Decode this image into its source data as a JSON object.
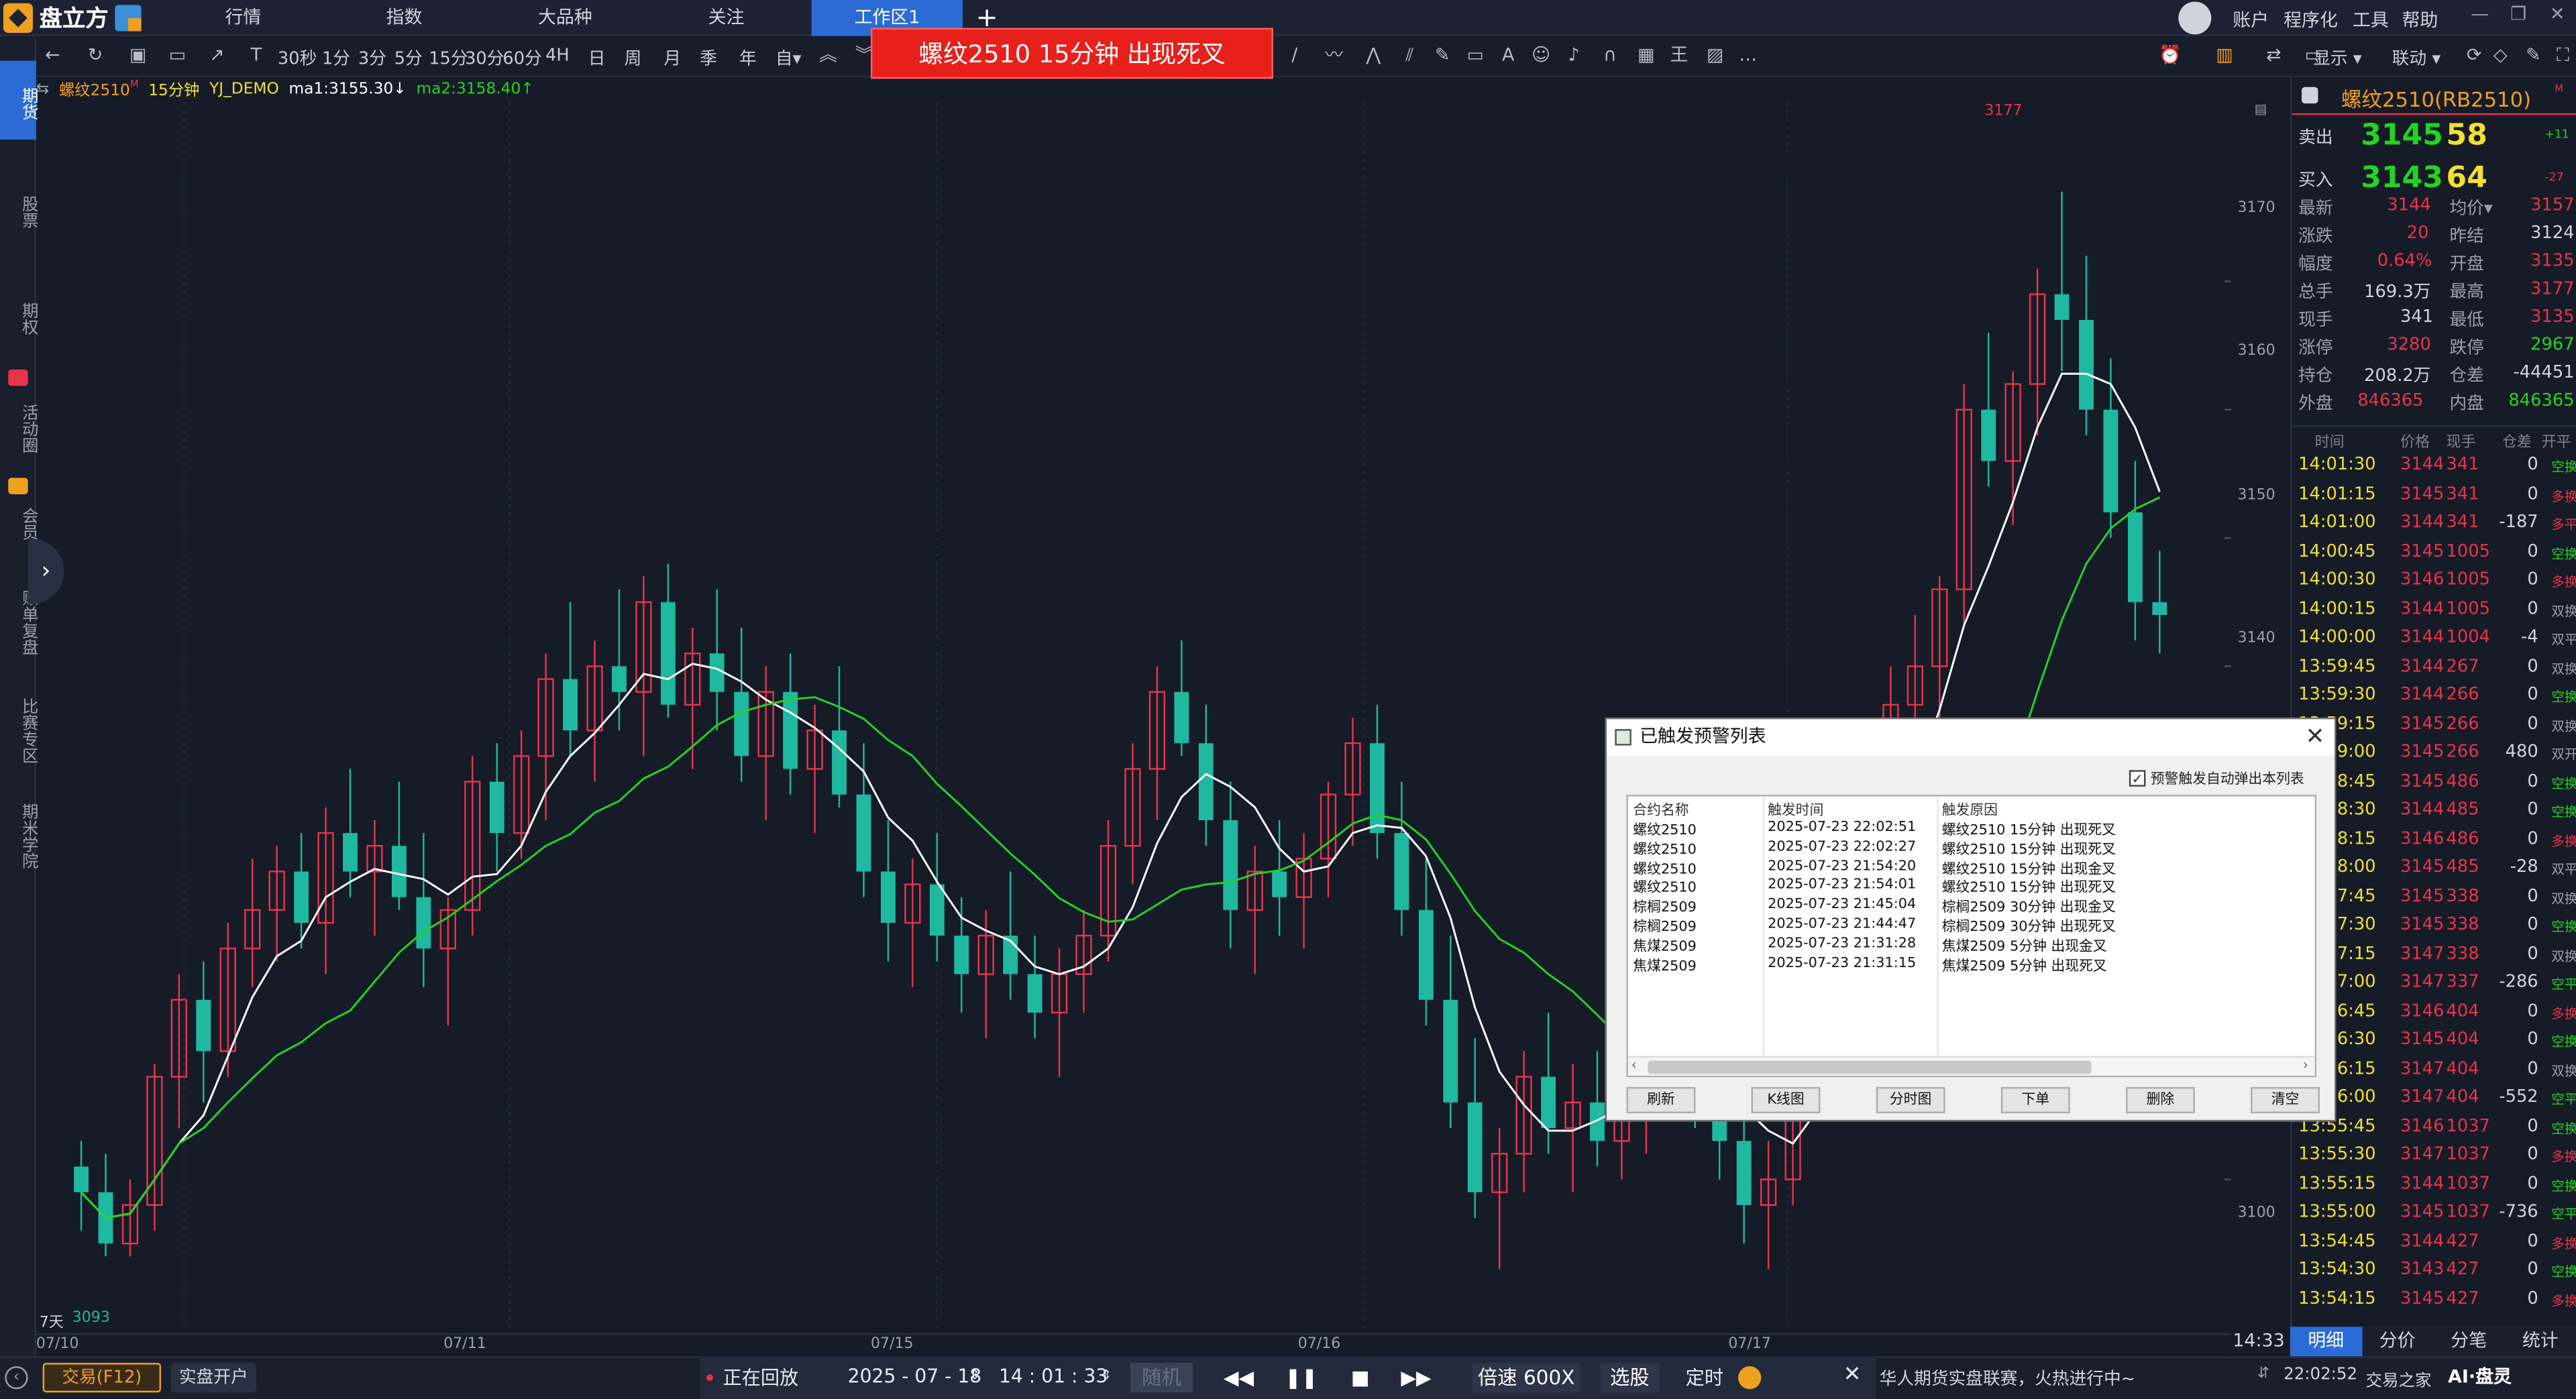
{
  "app": {
    "logo_text": "盘立方",
    "nav_tabs": [
      "行情",
      "指数",
      "大品种",
      "关注",
      "工作区1"
    ],
    "right_menu": [
      "账户",
      "程序化",
      "工具",
      "帮助"
    ]
  },
  "toolbar": {
    "periods": [
      "30秒",
      "1分",
      "3分",
      "5分",
      "15分",
      "30分",
      "60分",
      "4H",
      "日",
      "周",
      "月",
      "季",
      "年",
      "自▾"
    ],
    "right_buttons": [
      "显示 ▾",
      "联动 ▾"
    ]
  },
  "alert_banner": "螺纹2510 15分钟 出现死叉",
  "sidebar": [
    "期货",
    "股票",
    "期权",
    "活动圈",
    "会员",
    "账单复盘",
    "比赛专区",
    "期米学院"
  ],
  "legend": {
    "symbol": "螺纹2510",
    "symbol_sup": "M",
    "period": "15分钟",
    "account": "YJ_DEMO",
    "ma1": "ma1:3155.30↓",
    "ma2": "ma2:3158.40↑"
  },
  "colors": {
    "up": "#e8344a",
    "down": "#1fb8a0",
    "ma1": "#ffffff",
    "ma2": "#22d422",
    "accent": "#2b6bd6",
    "banner": "#e8201c",
    "price_yellow": "#f0e030"
  },
  "chart_data": {
    "type": "candlestick",
    "period": "15分钟",
    "ylim": [
      3088,
      3184
    ],
    "y_ticks": [
      3100,
      3140,
      3150,
      3160,
      3170
    ],
    "x_ticks": [
      "07/10",
      "07/11",
      "07/15",
      "07/16",
      "07/17"
    ],
    "high_label": "3177",
    "low_label": "3093",
    "days_label": "7天",
    "bars": [
      [
        3101,
        3103,
        3096,
        3099
      ],
      [
        3099,
        3102,
        3094,
        3095
      ],
      [
        3095,
        3100,
        3094,
        3098
      ],
      [
        3098,
        3109,
        3096,
        3108
      ],
      [
        3108,
        3116,
        3104,
        3114
      ],
      [
        3114,
        3117,
        3106,
        3110
      ],
      [
        3110,
        3120,
        3108,
        3118
      ],
      [
        3118,
        3125,
        3115,
        3121
      ],
      [
        3121,
        3126,
        3117,
        3124
      ],
      [
        3124,
        3127,
        3118,
        3120
      ],
      [
        3120,
        3129,
        3116,
        3127
      ],
      [
        3127,
        3132,
        3122,
        3124
      ],
      [
        3124,
        3128,
        3119,
        3126
      ],
      [
        3126,
        3131,
        3121,
        3122
      ],
      [
        3122,
        3127,
        3115,
        3118
      ],
      [
        3118,
        3122,
        3112,
        3121
      ],
      [
        3121,
        3133,
        3119,
        3131
      ],
      [
        3131,
        3134,
        3124,
        3127
      ],
      [
        3127,
        3135,
        3125,
        3133
      ],
      [
        3133,
        3141,
        3128,
        3139
      ],
      [
        3139,
        3145,
        3133,
        3135
      ],
      [
        3135,
        3142,
        3131,
        3140
      ],
      [
        3140,
        3146,
        3135,
        3138
      ],
      [
        3138,
        3147,
        3133,
        3145
      ],
      [
        3145,
        3148,
        3136,
        3137
      ],
      [
        3137,
        3143,
        3132,
        3141
      ],
      [
        3141,
        3146,
        3135,
        3138
      ],
      [
        3138,
        3143,
        3131,
        3133
      ],
      [
        3133,
        3140,
        3128,
        3138
      ],
      [
        3138,
        3141,
        3130,
        3132
      ],
      [
        3132,
        3137,
        3127,
        3135
      ],
      [
        3135,
        3140,
        3129,
        3130
      ],
      [
        3130,
        3134,
        3122,
        3124
      ],
      [
        3124,
        3128,
        3117,
        3120
      ],
      [
        3120,
        3125,
        3115,
        3123
      ],
      [
        3123,
        3127,
        3117,
        3119
      ],
      [
        3119,
        3122,
        3113,
        3116
      ],
      [
        3116,
        3121,
        3111,
        3119
      ],
      [
        3119,
        3124,
        3114,
        3116
      ],
      [
        3116,
        3119,
        3111,
        3113
      ],
      [
        3113,
        3118,
        3108,
        3116
      ],
      [
        3116,
        3121,
        3113,
        3119
      ],
      [
        3119,
        3128,
        3117,
        3126
      ],
      [
        3126,
        3134,
        3123,
        3132
      ],
      [
        3132,
        3140,
        3128,
        3138
      ],
      [
        3138,
        3142,
        3133,
        3134
      ],
      [
        3134,
        3137,
        3126,
        3128
      ],
      [
        3128,
        3131,
        3118,
        3121
      ],
      [
        3121,
        3126,
        3116,
        3124
      ],
      [
        3124,
        3128,
        3119,
        3122
      ],
      [
        3122,
        3127,
        3118,
        3125
      ],
      [
        3125,
        3131,
        3122,
        3130
      ],
      [
        3130,
        3136,
        3126,
        3134
      ],
      [
        3134,
        3137,
        3125,
        3127
      ],
      [
        3127,
        3131,
        3119,
        3121
      ],
      [
        3121,
        3125,
        3112,
        3114
      ],
      [
        3114,
        3119,
        3104,
        3106
      ],
      [
        3106,
        3111,
        3097,
        3099
      ],
      [
        3099,
        3104,
        3093,
        3102
      ],
      [
        3102,
        3110,
        3099,
        3108
      ],
      [
        3108,
        3113,
        3102,
        3104
      ],
      [
        3104,
        3109,
        3099,
        3106
      ],
      [
        3106,
        3110,
        3101,
        3103
      ],
      [
        3103,
        3108,
        3100,
        3107
      ],
      [
        3107,
        3111,
        3102,
        3109
      ],
      [
        3109,
        3114,
        3105,
        3112
      ],
      [
        3112,
        3115,
        3104,
        3106
      ],
      [
        3106,
        3110,
        3100,
        3103
      ],
      [
        3103,
        3107,
        3095,
        3098
      ],
      [
        3098,
        3103,
        3093,
        3100
      ],
      [
        3100,
        3108,
        3098,
        3107
      ],
      [
        3107,
        3121,
        3105,
        3119
      ],
      [
        3119,
        3130,
        3116,
        3127
      ],
      [
        3127,
        3136,
        3124,
        3133
      ],
      [
        3133,
        3140,
        3129,
        3137
      ],
      [
        3137,
        3144,
        3133,
        3140
      ],
      [
        3140,
        3147,
        3131,
        3146
      ],
      [
        3146,
        3162,
        3143,
        3160
      ],
      [
        3160,
        3166,
        3154,
        3156
      ],
      [
        3156,
        3163,
        3151,
        3162
      ],
      [
        3162,
        3171,
        3158,
        3169
      ],
      [
        3169,
        3177,
        3163,
        3167
      ],
      [
        3167,
        3172,
        3158,
        3160
      ],
      [
        3160,
        3164,
        3150,
        3152
      ],
      [
        3152,
        3156,
        3142,
        3145
      ],
      [
        3145,
        3149,
        3141,
        3144
      ]
    ],
    "ma1_note": "ma1 white line",
    "ma2_note": "ma2 green line"
  },
  "y_axis_labels": [
    "3170",
    "3160",
    "3150",
    "3140",
    "3100"
  ],
  "x_axis_labels": [
    "07/10",
    "07/11",
    "07/15",
    "07/16",
    "07/17"
  ],
  "quote": {
    "title": "螺纹2510(RB2510)",
    "title_sup": "M",
    "sell_label": "卖出",
    "sell_price": "3145",
    "sell_qty": "58",
    "sell_change": "+11",
    "buy_label": "买入",
    "buy_price": "3143",
    "buy_qty": "64",
    "buy_change": "-27",
    "rows": [
      {
        "l1": "最新",
        "v1": "3144",
        "l2": "均价▾",
        "v2": "3157"
      },
      {
        "l1": "涨跌",
        "v1": "20",
        "l2": "昨结",
        "v2": "3124"
      },
      {
        "l1": "幅度",
        "v1": "0.64%",
        "l2": "开盘",
        "v2": "3135"
      },
      {
        "l1": "总手",
        "v1": "169.3万",
        "l2": "最高",
        "v2": "3177"
      },
      {
        "l1": "现手",
        "v1": "341",
        "l2": "最低",
        "v2": "3135"
      },
      {
        "l1": "涨停",
        "v1": "3280",
        "l2": "跌停",
        "v2": "2967"
      },
      {
        "l1": "持仓",
        "v1": "208.2万",
        "l2": "仓差",
        "v2": "-44451"
      },
      {
        "l1": "外盘",
        "v1": "846365",
        "l2": "内盘",
        "v2": "846365"
      }
    ],
    "trade_headers": [
      "时间",
      "价格",
      "现手",
      "仓差",
      "开平"
    ],
    "trades": [
      {
        "t": "14:01:30",
        "p": "3144",
        "q": "341",
        "d": "0",
        "k": "空换"
      },
      {
        "t": "14:01:15",
        "p": "3145",
        "q": "341",
        "d": "0",
        "k": "多换"
      },
      {
        "t": "14:01:00",
        "p": "3144",
        "q": "341",
        "d": "-187",
        "k": "多平"
      },
      {
        "t": "14:00:45",
        "p": "3145",
        "q": "1005",
        "d": "0",
        "k": "空换"
      },
      {
        "t": "14:00:30",
        "p": "3146",
        "q": "1005",
        "d": "0",
        "k": "多换"
      },
      {
        "t": "14:00:15",
        "p": "3144",
        "q": "1005",
        "d": "0",
        "k": "双换"
      },
      {
        "t": "14:00:00",
        "p": "3144",
        "q": "1004",
        "d": "-4",
        "k": "双平"
      },
      {
        "t": "13:59:45",
        "p": "3144",
        "q": "267",
        "d": "0",
        "k": "双换"
      },
      {
        "t": "13:59:30",
        "p": "3144",
        "q": "266",
        "d": "0",
        "k": "空换"
      },
      {
        "t": "13:59:15",
        "p": "3145",
        "q": "266",
        "d": "0",
        "k": "双换"
      },
      {
        "t": "13:59:00",
        "p": "3145",
        "q": "266",
        "d": "480",
        "k": "双开"
      },
      {
        "t": "13:58:45",
        "p": "3145",
        "q": "486",
        "d": "0",
        "k": "空换"
      },
      {
        "t": "13:58:30",
        "p": "3144",
        "q": "485",
        "d": "0",
        "k": "空换"
      },
      {
        "t": "13:58:15",
        "p": "3146",
        "q": "486",
        "d": "0",
        "k": "多换"
      },
      {
        "t": "13:58:00",
        "p": "3145",
        "q": "485",
        "d": "-28",
        "k": "双平"
      },
      {
        "t": "13:57:45",
        "p": "3145",
        "q": "338",
        "d": "0",
        "k": "双换"
      },
      {
        "t": "13:57:30",
        "p": "3145",
        "q": "338",
        "d": "0",
        "k": "空换"
      },
      {
        "t": "13:57:15",
        "p": "3147",
        "q": "338",
        "d": "0",
        "k": "双换"
      },
      {
        "t": "13:57:00",
        "p": "3147",
        "q": "337",
        "d": "-286",
        "k": "空平"
      },
      {
        "t": "13:56:45",
        "p": "3146",
        "q": "404",
        "d": "0",
        "k": "多换"
      },
      {
        "t": "13:56:30",
        "p": "3145",
        "q": "404",
        "d": "0",
        "k": "空换"
      },
      {
        "t": "13:56:15",
        "p": "3147",
        "q": "404",
        "d": "0",
        "k": "双换"
      },
      {
        "t": "13:56:00",
        "p": "3147",
        "q": "404",
        "d": "-552",
        "k": "空平"
      },
      {
        "t": "13:55:45",
        "p": "3146",
        "q": "1037",
        "d": "0",
        "k": "空换"
      },
      {
        "t": "13:55:30",
        "p": "3147",
        "q": "1037",
        "d": "0",
        "k": "多换"
      },
      {
        "t": "13:55:15",
        "p": "3144",
        "q": "1037",
        "d": "0",
        "k": "空换"
      },
      {
        "t": "13:55:00",
        "p": "3145",
        "q": "1037",
        "d": "-736",
        "k": "空平"
      },
      {
        "t": "13:54:45",
        "p": "3144",
        "q": "427",
        "d": "0",
        "k": "多换"
      },
      {
        "t": "13:54:30",
        "p": "3143",
        "q": "427",
        "d": "0",
        "k": "空换"
      },
      {
        "t": "13:54:15",
        "p": "3145",
        "q": "427",
        "d": "0",
        "k": "多换"
      }
    ],
    "tabs": [
      "明细",
      "分价",
      "分笔",
      "统计"
    ],
    "time_label": "14:33"
  },
  "playbar": {
    "status": "正在回放",
    "date": "2025 - 07 - 18",
    "time": "14 : 01 : 33",
    "random": "随机",
    "speed_label": "倍速",
    "speed": "600X",
    "pick": "选股",
    "timer": "定时"
  },
  "statusbar": {
    "trade_btn": "交易(F12)",
    "open_account": "实盘开户",
    "ticker": "华人期货实盘联赛，火热进行中~",
    "clock": "22:02:52",
    "home": "交易之家",
    "ai": "AI·盘灵"
  },
  "dialog": {
    "title": "已触发预警列表",
    "auto_popup": "预警触发自动弹出本列表",
    "headers": [
      "合约名称",
      "触发时间",
      "触发原因"
    ],
    "rows": [
      {
        "name": "螺纹2510",
        "time": "2025-07-23 22:02:51",
        "reason": "螺纹2510 15分钟 出现死叉"
      },
      {
        "name": "螺纹2510",
        "time": "2025-07-23 22:02:27",
        "reason": "螺纹2510 15分钟 出现死叉"
      },
      {
        "name": "螺纹2510",
        "time": "2025-07-23 21:54:20",
        "reason": "螺纹2510 15分钟 出现金叉"
      },
      {
        "name": "螺纹2510",
        "time": "2025-07-23 21:54:01",
        "reason": "螺纹2510 15分钟 出现死叉"
      },
      {
        "name": "棕榈2509",
        "time": "2025-07-23 21:45:04",
        "reason": "棕榈2509 30分钟 出现金叉"
      },
      {
        "name": "棕榈2509",
        "time": "2025-07-23 21:44:47",
        "reason": "棕榈2509 30分钟 出现死叉"
      },
      {
        "name": "焦煤2509",
        "time": "2025-07-23 21:31:28",
        "reason": "焦煤2509 5分钟 出现金叉"
      },
      {
        "name": "焦煤2509",
        "time": "2025-07-23 21:31:15",
        "reason": "焦煤2509 5分钟 出现死叉"
      }
    ],
    "buttons": [
      "刷新",
      "K线图",
      "分时图",
      "下单",
      "删除",
      "清空"
    ]
  }
}
